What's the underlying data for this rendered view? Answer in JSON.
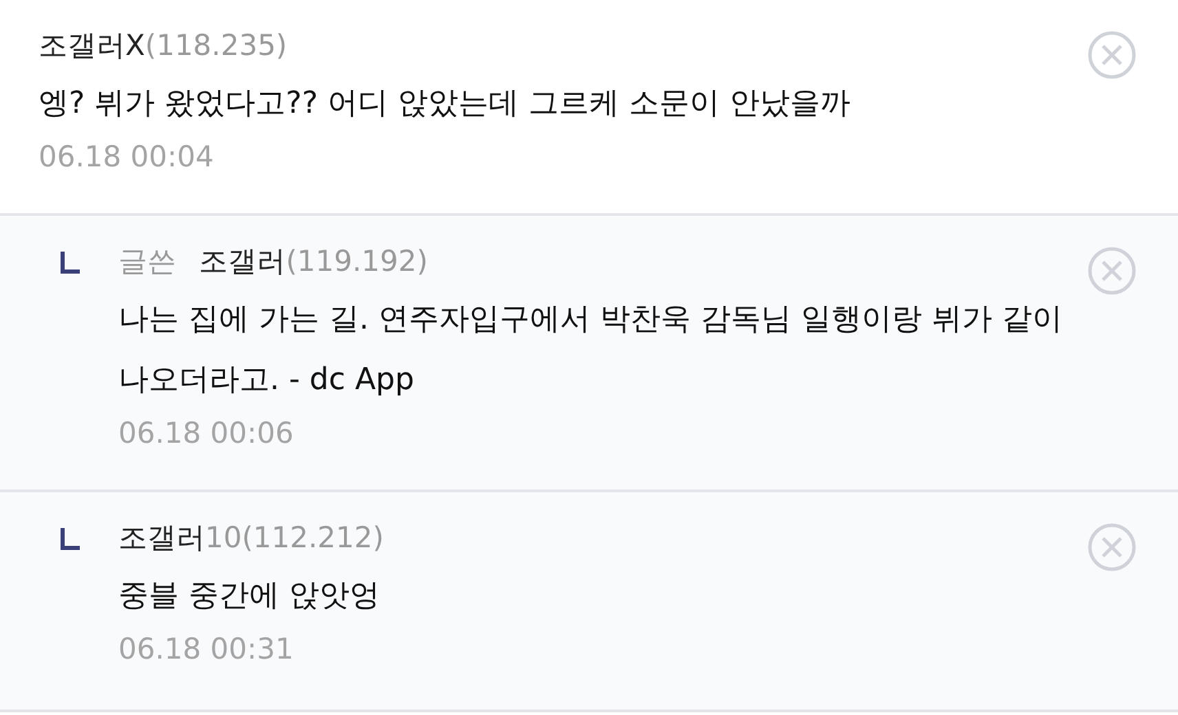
{
  "comments": [
    {
      "kind": "comment",
      "nick": "조갤러X",
      "ip": "(118.235)",
      "text": "엥? 뷔가 왔었다고?? 어디 앉았는데 그르케 소문이 안났을까",
      "time": "06.18 00:04"
    },
    {
      "kind": "reply",
      "writer_label": "글쓴",
      "nick": "조갤러",
      "ip": "(119.192)",
      "text": "나는 집에 가는 길. 연주자입구에서 박찬욱 감독님 일행이랑 뷔가 같이 나오더라고. - dc App",
      "time": "06.18 00:06"
    },
    {
      "kind": "reply",
      "nick": "조갤러",
      "ip": "10(112.212)",
      "text": "중블 중간에 앉앗엉",
      "time": "06.18 00:31"
    }
  ]
}
